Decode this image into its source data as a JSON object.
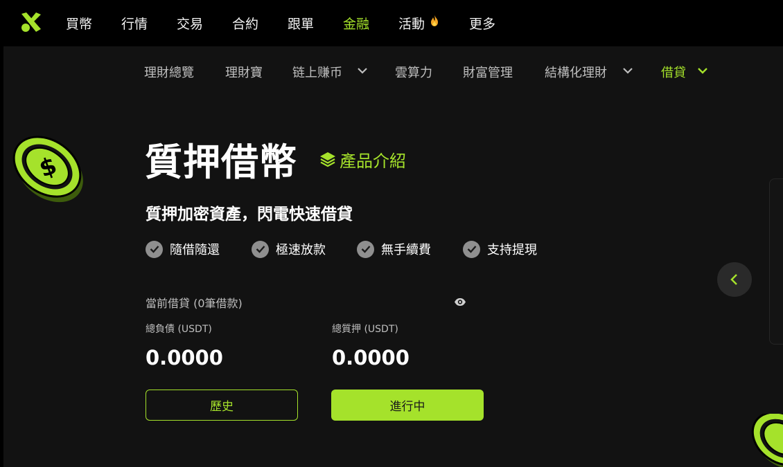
{
  "topnav": {
    "items": [
      "買幣",
      "行情",
      "交易",
      "合約",
      "跟單",
      "金融",
      "活動",
      "更多"
    ],
    "active_index": 5
  },
  "subnav": {
    "items": [
      "理財總覽",
      "理財寶",
      "链上赚币",
      "雲算力",
      "財富管理",
      "結構化理財",
      "借貸"
    ]
  },
  "hero": {
    "title": "質押借幣",
    "intro_link": "產品介紹",
    "subtitle": "質押加密資產，閃電快速借貸"
  },
  "features": [
    "隨借隨還",
    "極速放款",
    "無手續費",
    "支持提現"
  ],
  "loans": {
    "label": "當前借貸 (0筆借款)",
    "total_debt_label": "總負債 (USDT)",
    "total_debt_value": "0.0000",
    "total_collateral_label": "總質押 (USDT)",
    "total_collateral_value": "0.0000"
  },
  "buttons": {
    "history": "歷史",
    "in_progress": "進行中"
  },
  "colors": {
    "accent": "#a5e22b",
    "background": "#121212",
    "topbar": "#000000",
    "muted_text": "#bfbfbf"
  }
}
